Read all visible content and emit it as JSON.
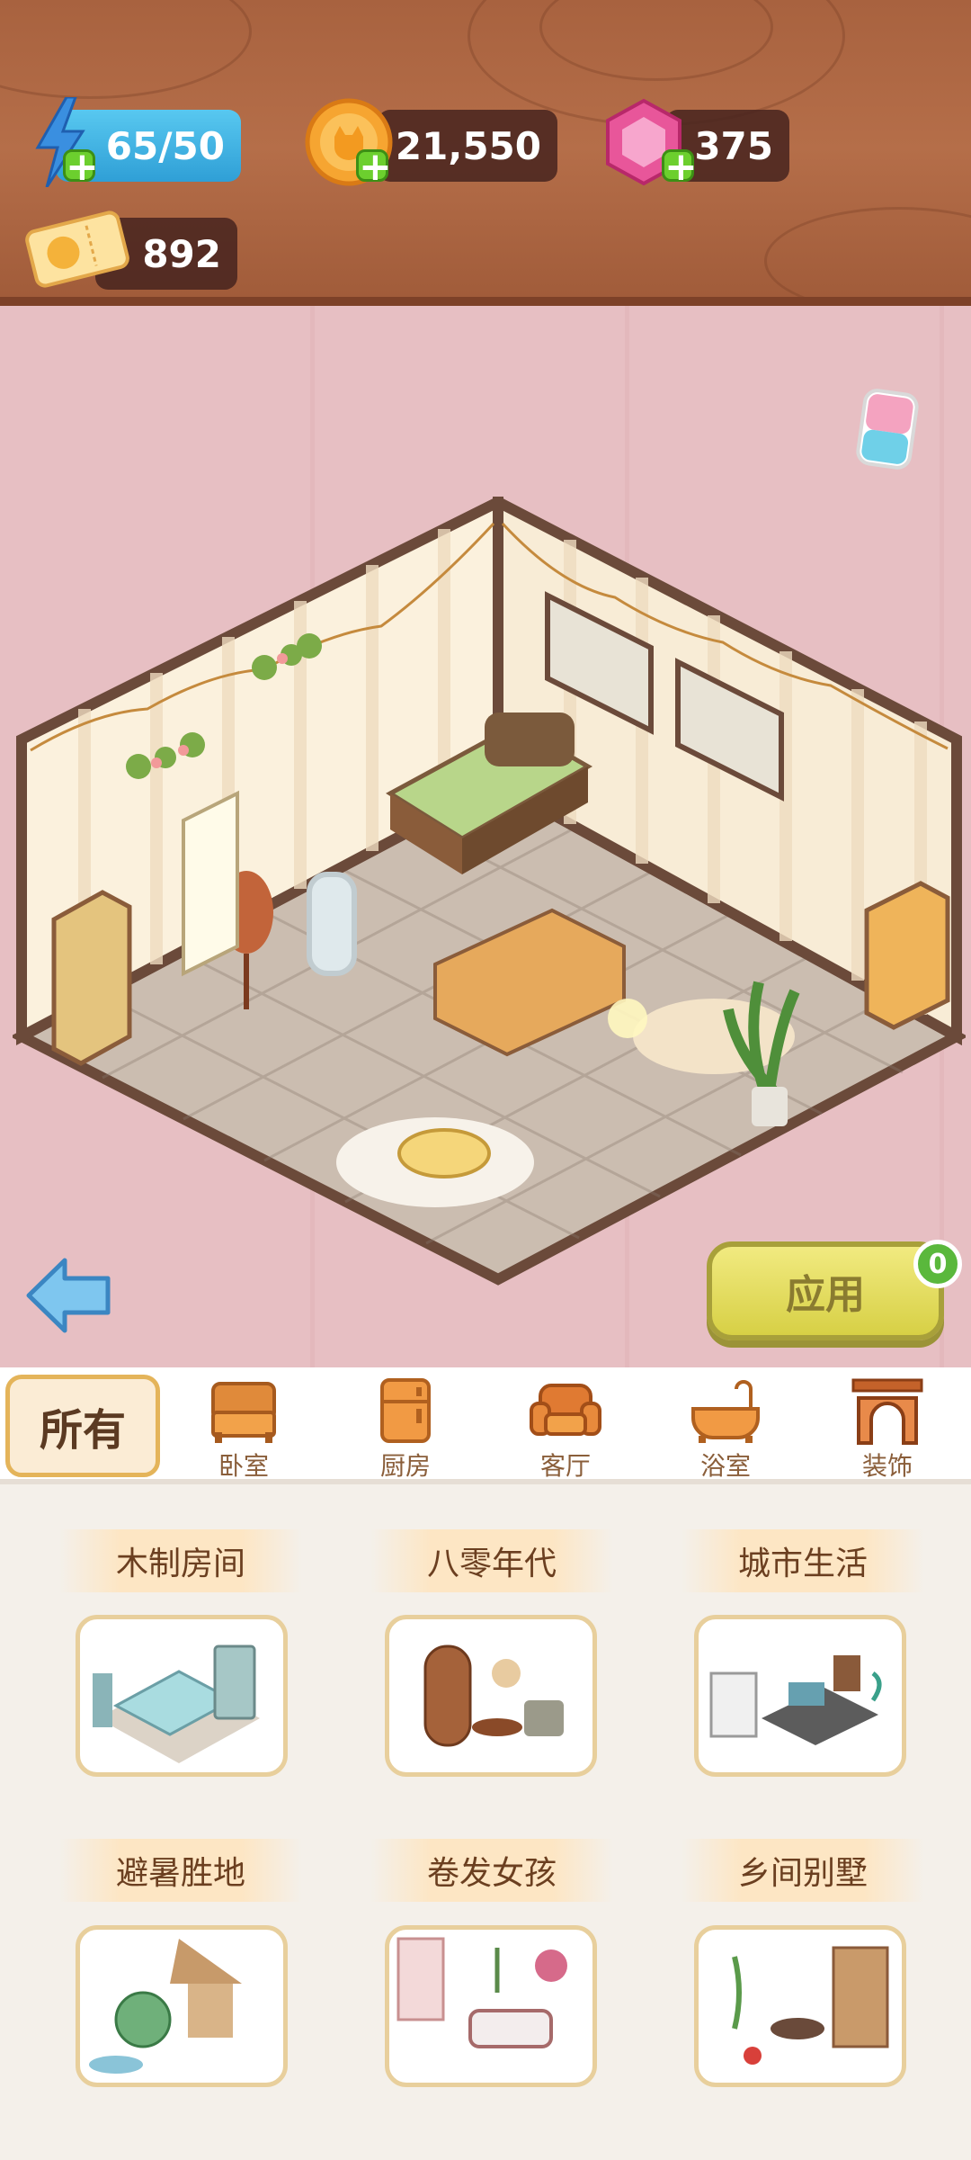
{
  "resources": {
    "energy": "65/50",
    "coins": "21,550",
    "gems": "375",
    "tickets": "892"
  },
  "room": {
    "apply_label": "应用",
    "apply_badge": "0"
  },
  "tabs": {
    "all": "所有",
    "items": [
      {
        "label": "卧室",
        "icon": "bed-icon"
      },
      {
        "label": "厨房",
        "icon": "fridge-icon"
      },
      {
        "label": "客厅",
        "icon": "sofa-icon"
      },
      {
        "label": "浴室",
        "icon": "bathtub-icon"
      },
      {
        "label": "装饰",
        "icon": "arch-icon"
      }
    ]
  },
  "themes": [
    {
      "title": "木制房间"
    },
    {
      "title": "八零年代"
    },
    {
      "title": "城市生活"
    },
    {
      "title": "避暑胜地"
    },
    {
      "title": "卷发女孩"
    },
    {
      "title": "乡间别墅"
    }
  ],
  "colors": {
    "wood": "#a8623f",
    "room_bg": "#e7bfc3",
    "apply": "#e4dc60",
    "accent": "#e4b45a"
  }
}
